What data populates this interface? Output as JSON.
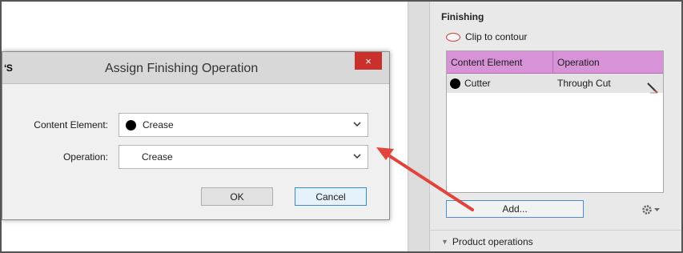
{
  "dialog": {
    "app_badge": "‘S",
    "title": "Assign Finishing Operation",
    "close_glyph": "×",
    "content_element_label": "Content Element:",
    "content_element_value": "Crease",
    "operation_label": "Operation:",
    "operation_value": "Crease",
    "ok_label": "OK",
    "cancel_label": "Cancel"
  },
  "panel": {
    "title": "Finishing",
    "clip_label": "Clip to contour",
    "columns": [
      "Content Element",
      "Operation"
    ],
    "rows": [
      {
        "element": "Cutter",
        "operation": "Through Cut"
      }
    ],
    "add_label": "Add...",
    "product_operations_label": "Product operations"
  },
  "colors": {
    "header_accent": "#d792d8",
    "close_button": "#c9302c",
    "arrow": "#e0443a",
    "focus_border": "#4a8fd6"
  },
  "icons": [
    "close-icon",
    "chevron-down-icon",
    "pen-icon",
    "gear-icon",
    "clip-oval-icon",
    "triangle-icon"
  ]
}
